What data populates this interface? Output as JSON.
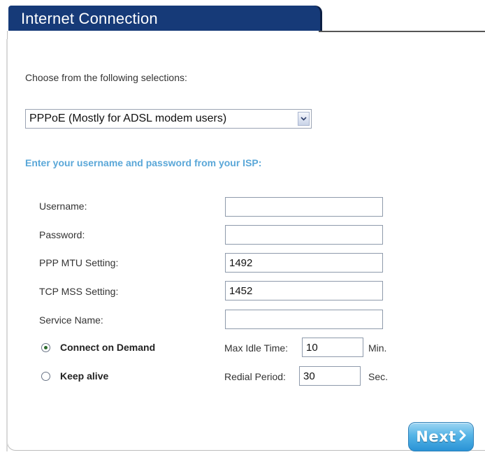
{
  "header": {
    "title": "Internet Connection"
  },
  "intro_text": "Choose from the following selections:",
  "connection_type": {
    "selected": "PPPoE (Mostly for ADSL modem users)"
  },
  "section_heading": "Enter your username and password from your ISP:",
  "fields": {
    "username": {
      "label": "Username:",
      "value": ""
    },
    "password": {
      "label": "Password:",
      "value": ""
    },
    "ppp_mtu": {
      "label": "PPP MTU Setting:",
      "value": "1492"
    },
    "tcp_mss": {
      "label": "TCP MSS Setting:",
      "value": "1452"
    },
    "service_name": {
      "label": "Service Name:",
      "value": ""
    }
  },
  "connect_mode": {
    "on_demand": {
      "label": "Connect on Demand",
      "checked": true,
      "param_label": "Max Idle Time:",
      "value": "10",
      "unit": "Min."
    },
    "keep_alive": {
      "label": "Keep alive",
      "checked": false,
      "param_label": "Redial Period:",
      "value": "30",
      "unit": "Sec."
    }
  },
  "buttons": {
    "next_label": "Next"
  },
  "colors": {
    "title_bar": "#163a78",
    "heading": "#5aa7d8",
    "button": "#3aa0dd"
  },
  "icons": {
    "dropdown": "chevron-down-icon",
    "next": "chevron-right-icon"
  }
}
